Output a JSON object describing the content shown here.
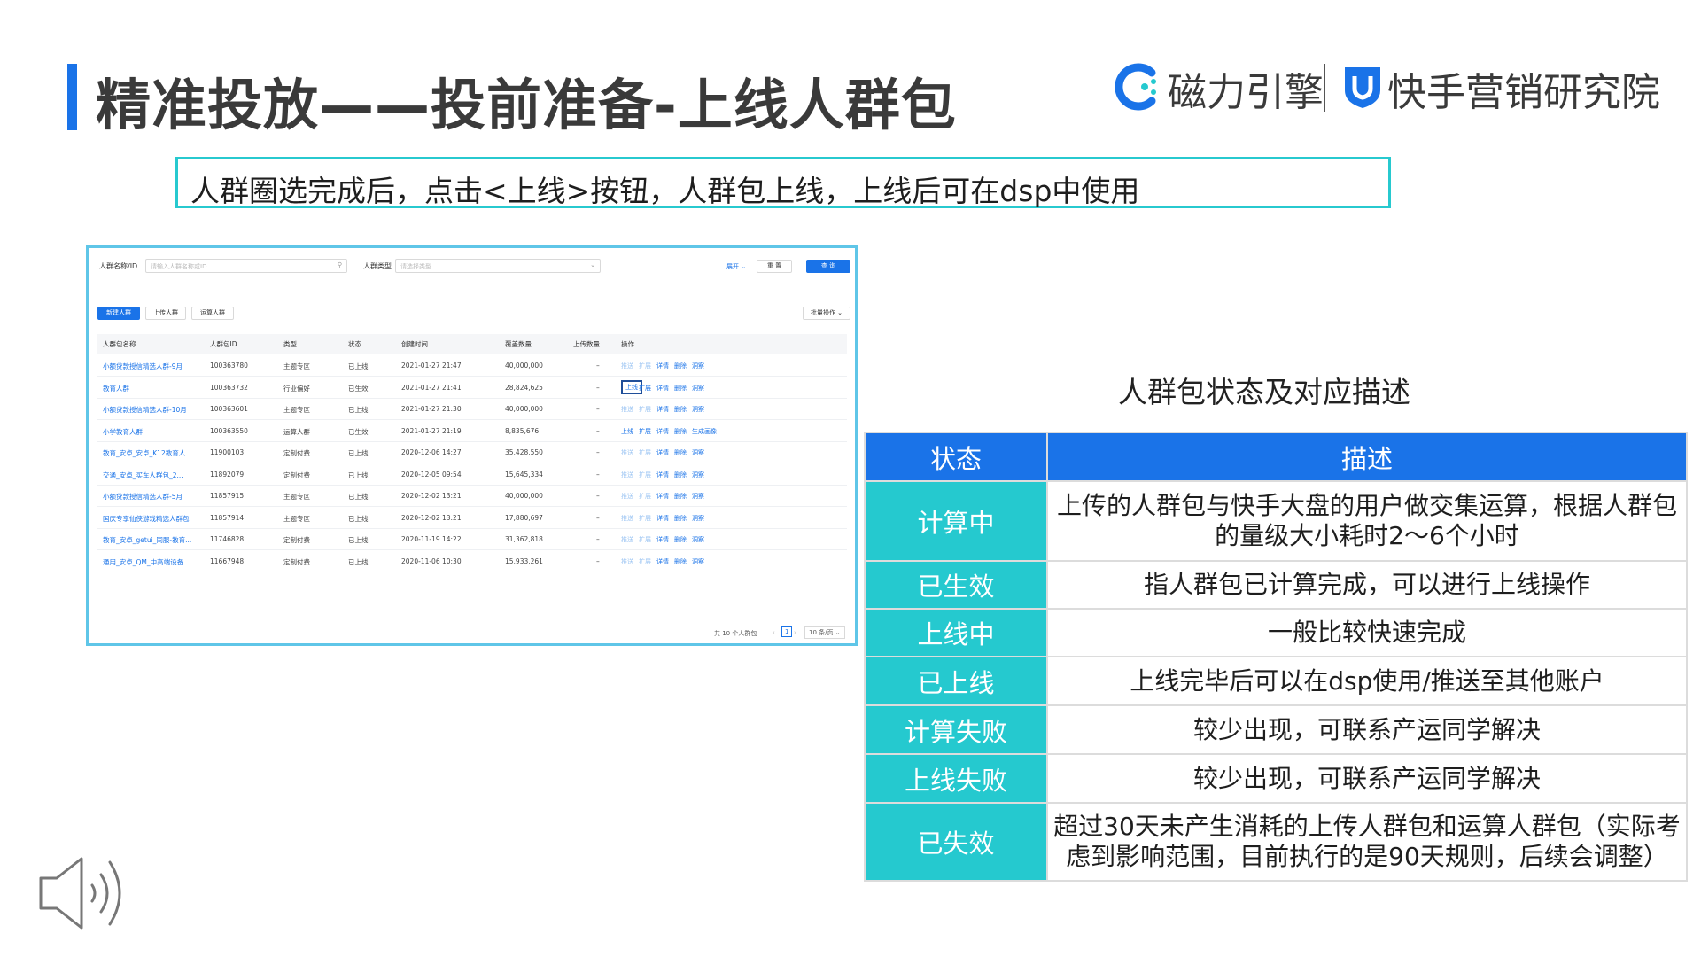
{
  "slide": {
    "title": "精准投放——投前准备-上线人群包",
    "logo1": "磁力引擎",
    "logo2": "快手营销研究院",
    "banner": "人群圈选完成后，点击<上线>按钮，人群包上线，上线后可在dsp中使用"
  },
  "screenshot": {
    "filters": {
      "name_label": "人群名称/ID",
      "name_placeholder": "请输入人群名称或ID",
      "type_label": "人群类型",
      "type_placeholder": "请选择类型",
      "expand_label": "展开",
      "reset_label": "重 置",
      "query_label": "查 询"
    },
    "actions": {
      "new_label": "新建人群",
      "upload_label": "上传人群",
      "compute_label": "运算人群",
      "batch_label": "批量操作"
    },
    "columns": [
      "人群包名称",
      "人群包ID",
      "类型",
      "状态",
      "创建时间",
      "覆盖数量",
      "上传数量",
      "操作"
    ],
    "rows": [
      {
        "name": "小额贷款授信精选人群-9月",
        "id": "100363780",
        "type": "主题专区",
        "status": "已上线",
        "time": "2021-01-27 21:47",
        "coverage": "40,000,000",
        "uploaded": "–",
        "ops": [
          "推送",
          "扩展",
          "详情",
          "删除",
          "洞察"
        ],
        "online_active": false
      },
      {
        "name": "教育人群",
        "id": "100363732",
        "type": "行业偏好",
        "status": "已生效",
        "time": "2021-01-27 21:41",
        "coverage": "28,824,625",
        "uploaded": "–",
        "ops": [
          "上线",
          "扩展",
          "详情",
          "删除",
          "洞察"
        ],
        "online_active": true,
        "highlight": true
      },
      {
        "name": "小额贷款授信精选人群-10月",
        "id": "100363601",
        "type": "主题专区",
        "status": "已上线",
        "time": "2021-01-27 21:30",
        "coverage": "40,000,000",
        "uploaded": "–",
        "ops": [
          "推送",
          "扩展",
          "详情",
          "删除",
          "洞察"
        ],
        "online_active": false
      },
      {
        "name": "小学教育人群",
        "id": "100363550",
        "type": "运算人群",
        "status": "已生效",
        "time": "2021-01-27 21:19",
        "coverage": "8,835,676",
        "uploaded": "–",
        "ops": [
          "上线",
          "扩展",
          "详情",
          "删除",
          "生成画像"
        ],
        "online_active": true
      },
      {
        "name": "教育_安卓_安卓_K12教育人...",
        "id": "11900103",
        "type": "定制付费",
        "status": "已上线",
        "time": "2020-12-06 14:27",
        "coverage": "35,428,550",
        "uploaded": "–",
        "ops": [
          "推送",
          "扩展",
          "详情",
          "删除",
          "洞察"
        ],
        "online_active": false
      },
      {
        "name": "交通_安卓_买车人群包_2...",
        "id": "11892079",
        "type": "定制付费",
        "status": "已上线",
        "time": "2020-12-05 09:54",
        "coverage": "15,645,334",
        "uploaded": "–",
        "ops": [
          "推送",
          "扩展",
          "详情",
          "删除",
          "洞察"
        ],
        "online_active": false
      },
      {
        "name": "小额贷款授信精选人群-5月",
        "id": "11857915",
        "type": "主题专区",
        "status": "已上线",
        "time": "2020-12-02 13:21",
        "coverage": "40,000,000",
        "uploaded": "–",
        "ops": [
          "推送",
          "扩展",
          "详情",
          "删除",
          "洞察"
        ],
        "online_active": false
      },
      {
        "name": "国庆专享仙侠游戏精选人群包",
        "id": "11857914",
        "type": "主题专区",
        "status": "已上线",
        "time": "2020-12-02 13:21",
        "coverage": "17,880,697",
        "uploaded": "–",
        "ops": [
          "推送",
          "扩展",
          "详情",
          "删除",
          "洞察"
        ],
        "online_active": false
      },
      {
        "name": "教育_安卓_getui_同服-教育...",
        "id": "11746828",
        "type": "定制付费",
        "status": "已上线",
        "time": "2020-11-19 14:22",
        "coverage": "31,362,818",
        "uploaded": "–",
        "ops": [
          "推送",
          "扩展",
          "详情",
          "删除",
          "洞察"
        ],
        "online_active": false
      },
      {
        "name": "通用_安卓_QM_中高端设备...",
        "id": "11667948",
        "type": "定制付费",
        "status": "已上线",
        "time": "2020-11-06 10:30",
        "coverage": "15,933,261",
        "uploaded": "–",
        "ops": [
          "推送",
          "扩展",
          "详情",
          "删除",
          "洞察"
        ],
        "online_active": false
      }
    ],
    "footer": {
      "total": "共 10 个人群包",
      "page": "1",
      "page_size": "10 条/页"
    }
  },
  "status_table": {
    "title": "人群包状态及对应描述",
    "header_status": "状态",
    "header_desc": "描述",
    "rows": [
      {
        "status": "计算中",
        "desc": "上传的人群包与快手大盘的用户做交集运算，根据人群包的量级大小耗时2～6个小时"
      },
      {
        "status": "已生效",
        "desc": "指人群包已计算完成，可以进行上线操作"
      },
      {
        "status": "上线中",
        "desc": "一般比较快速完成"
      },
      {
        "status": "已上线",
        "desc": "上线完毕后可以在dsp使用/推送至其他账户"
      },
      {
        "status": "计算失败",
        "desc": "较少出现，可联系产运同学解决"
      },
      {
        "status": "上线失败",
        "desc": "较少出现，可联系产运同学解决"
      },
      {
        "status": "已失效",
        "desc": "超过30天未产生消耗的上传人群包和运算人群包（实际考虑到影响范围，目前执行的是90天规则，后续会调整）"
      }
    ]
  },
  "colors": {
    "accent_blue": "#1a73e8",
    "status_cyan": "#25c9cf",
    "banner_border": "#27c9cf"
  },
  "icons": [
    "speaker-icon",
    "magnet-engine-logo-icon",
    "kuaishou-shield-logo-icon",
    "search-icon",
    "chevron-down-icon"
  ]
}
